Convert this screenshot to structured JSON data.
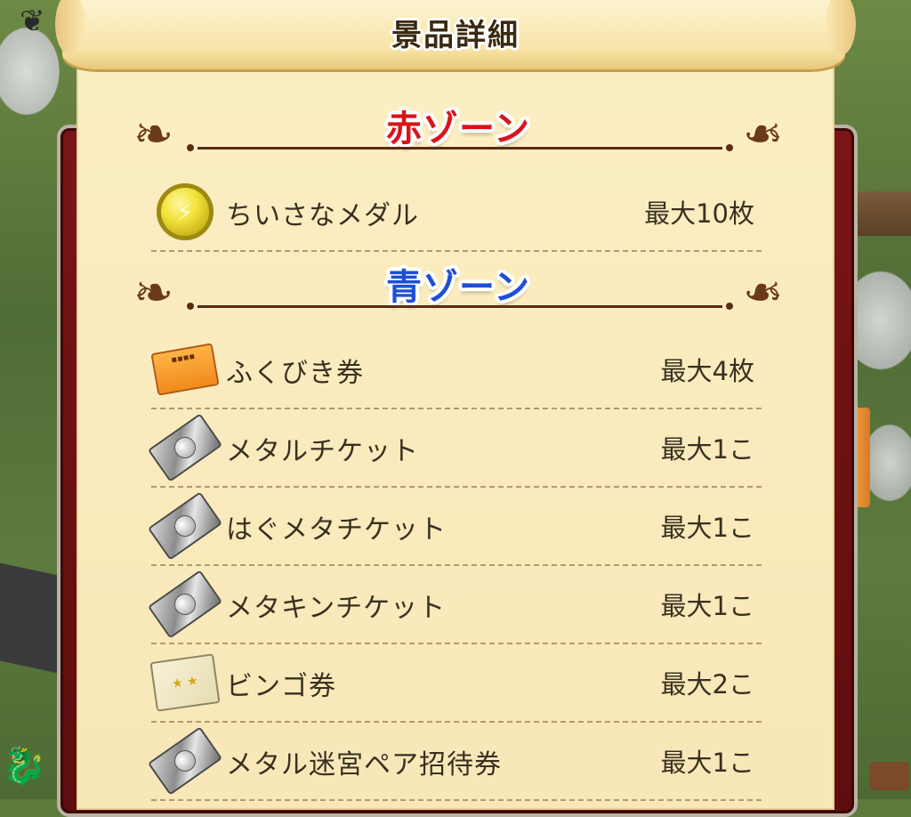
{
  "title": "景品詳細",
  "zones": [
    {
      "label": "赤ゾーン",
      "color": "#d8141a",
      "items": [
        {
          "name": "ちいさなメダル",
          "qty": "最大10枚",
          "icon": "small-medal-icon"
        }
      ]
    },
    {
      "label": "青ゾーン",
      "color": "#1f4fd6",
      "items": [
        {
          "name": "ふくびき券",
          "qty": "最大4枚",
          "icon": "lottery-ticket-icon"
        },
        {
          "name": "メタルチケット",
          "qty": "最大1こ",
          "icon": "metal-ticket-icon"
        },
        {
          "name": "はぐメタチケット",
          "qty": "最大1こ",
          "icon": "hagu-meta-ticket-icon"
        },
        {
          "name": "メタキンチケット",
          "qty": "最大1こ",
          "icon": "metakin-ticket-icon"
        },
        {
          "name": "ビンゴ券",
          "qty": "最大2こ",
          "icon": "bingo-ticket-icon"
        },
        {
          "name": "メタル迷宮ペア招待券",
          "qty": "最大1こ",
          "icon": "metal-labyrinth-pair-ticket-icon"
        }
      ]
    }
  ]
}
